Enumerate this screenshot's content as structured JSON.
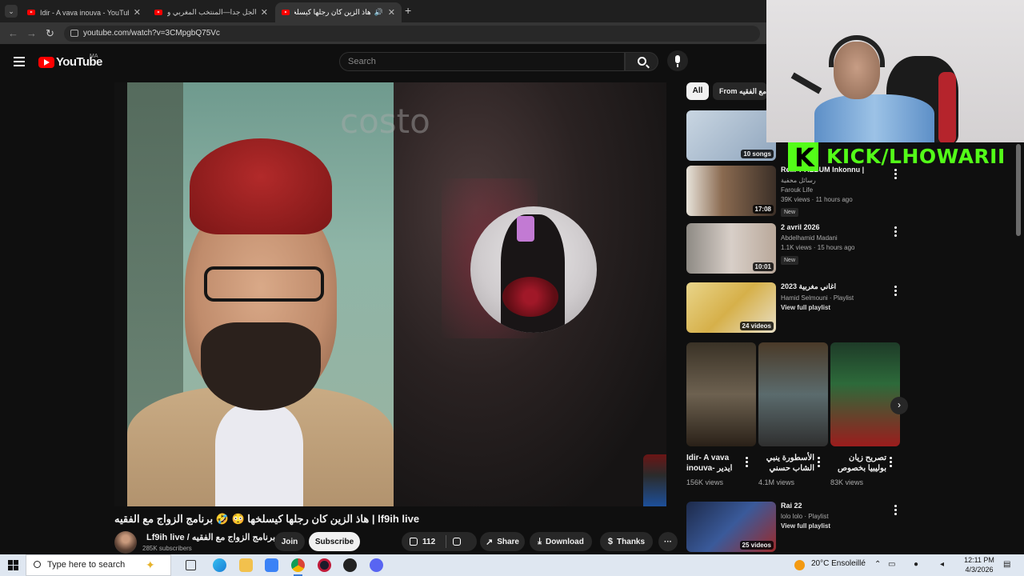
{
  "browser": {
    "tabs": [
      {
        "label": "Idir - A vava inouva - YouTube",
        "active": false
      },
      {
        "label": "عالجل جدا—المنتخب المغربي و",
        "active": false
      },
      {
        "label": "هاذ الزين كان رجلها كيسلخها",
        "active": true
      }
    ],
    "new_tab": "+",
    "url": "youtube.com/watch?v=3CMpgbQ75Vc"
  },
  "youtube": {
    "logo_text": "YouTube",
    "country_code": "MA",
    "search_placeholder": "Search"
  },
  "player": {
    "watermark": "costo"
  },
  "video": {
    "title": "هاذ الزين كان رجلها كيسلخها 😳 🤣 برنامج الزواج مع الفقيه | lf9ih live",
    "channel_name": "Lf9ih live / برنامج الزواج مع الفقيه",
    "subscribers": "285K subscribers",
    "join_label": "Join",
    "subscribe_label": "Subscribe",
    "likes": "112",
    "share_label": "Share",
    "download_label": "Download",
    "thanks_label": "Thanks"
  },
  "sidebar": {
    "chips": [
      "All",
      "From برنامج الزواج مع الفقيه"
    ],
    "recommendations": [
      {
        "title": "",
        "sub": "",
        "sub2": "",
        "duration": "10 songs",
        "badge": "",
        "thumb_color": "#a8b8c8"
      },
      {
        "title": "Re... T ALBUM Inkonnu |",
        "sub": "رسائل مخفية",
        "sub2": "Farouk Life",
        "sub3": "39K views · 11 hours ago",
        "duration": "17:08",
        "badge": "New",
        "thumb_color": "#8a6a50"
      },
      {
        "title": "2 avril 2026",
        "sub": "Abdelhamid Madani",
        "sub2": "1.1K views · 15 hours ago",
        "duration": "10:01",
        "badge": "New",
        "thumb_color": "#b9a89a"
      },
      {
        "title": "اغاني مغربية 2023",
        "sub": "Hamid Selmouni · Playlist",
        "sub2": "View full playlist",
        "duration": "24 videos",
        "badge": "",
        "thumb_color": "#d6b04a"
      }
    ],
    "shorts": [
      {
        "title": "Idir- A vava inouva- ايدير",
        "views": "156K views",
        "color": "#6d6150"
      },
      {
        "title": "الأسطورة ينبي الشاب حسني",
        "views": "4.1M views",
        "color": "#5b6b6d"
      },
      {
        "title": "تصريح زيان بوليبيا بخصوص",
        "views": "83K views",
        "color": "#2d6a3a"
      }
    ],
    "last_rec": {
      "title": "Rai 22",
      "sub": "lolo lolo · Playlist",
      "sub2": "View full playlist",
      "duration": "25 videos"
    }
  },
  "overlay": {
    "kick_text": "KICK/LHOWARII"
  },
  "taskbar": {
    "search_placeholder": "Type here to search",
    "weather": "20°C  Ensoleillé",
    "time": "12:11 PM",
    "date": "4/3/2026"
  }
}
